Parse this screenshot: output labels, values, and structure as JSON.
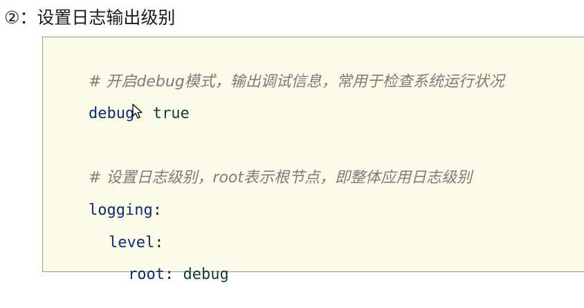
{
  "heading": "②：设置日志输出级别",
  "code": {
    "comment1": "# 开启debug模式，输出调试信息，常用于检查系统运行状况",
    "debug_key": "debug",
    "colon": ":",
    "debug_value": "true",
    "comment2": "# 设置日志级别，root表示根节点，即整体应用日志级别",
    "logging_key": "logging",
    "level_key": "level",
    "root_key": "root",
    "root_value": "debug"
  },
  "colors": {
    "block_background": "#fcfbe8",
    "comment": "#7b7b7b",
    "key": "#0a2a7a",
    "value": "#0d3d3d"
  },
  "icons": {
    "cursor": "mouse-pointer-icon"
  }
}
